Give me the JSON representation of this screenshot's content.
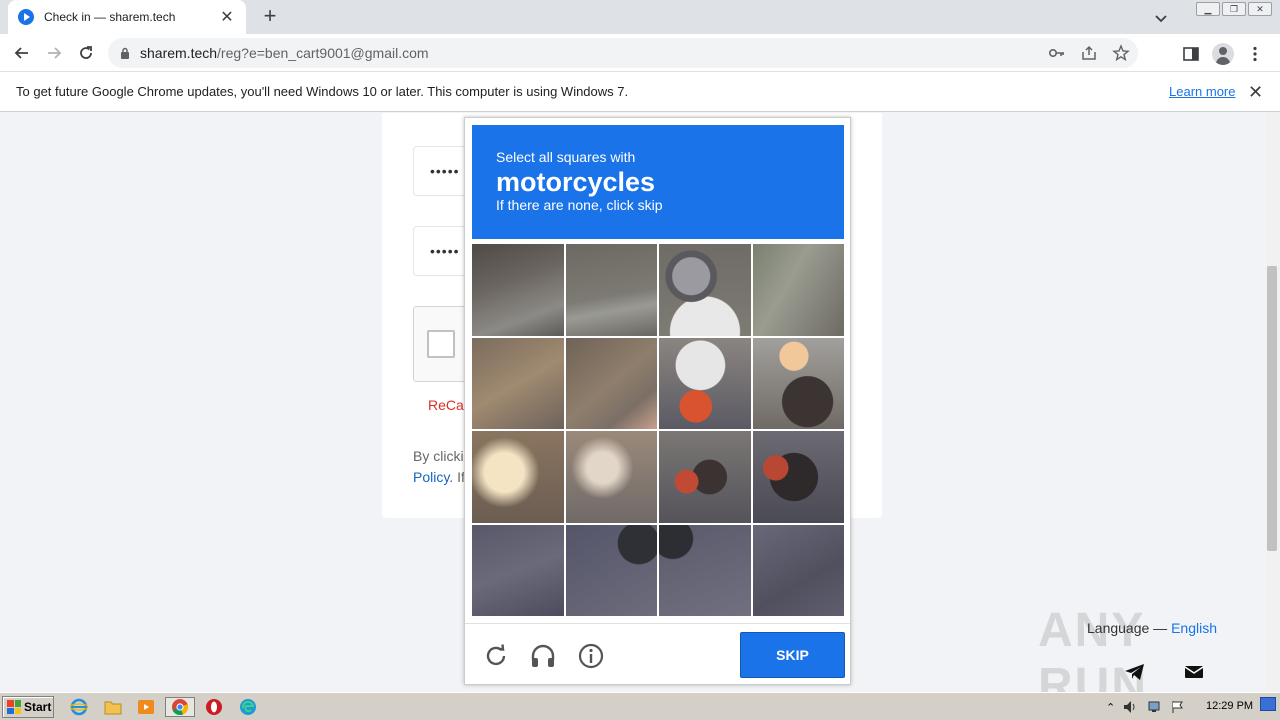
{
  "browser": {
    "tab_title": "Check in — sharem.tech",
    "url_host": "sharem.tech",
    "url_path": "/reg?e=ben_cart9001@gmail.com"
  },
  "infobar": {
    "message": "To get future Google Chrome updates, you'll need Windows 10 or later. This computer is using Windows 7.",
    "link_label": "Learn more"
  },
  "form": {
    "password_mask": "•••••",
    "confirm_mask": "•••••",
    "recaptcha_label": "ReCap",
    "by_clicking_text": "By clicki",
    "policy_link": "Policy.",
    "policy_rest": " If"
  },
  "captcha": {
    "line1": "Select all squares with",
    "keyword": "motorcycles",
    "line3": "If there are none, click skip",
    "skip_label": "SKIP",
    "icons": [
      "reload-icon",
      "headphones-icon",
      "info-icon"
    ]
  },
  "footer": {
    "language_prefix": "Language — ",
    "language_value": "English",
    "watermark": "ANY RUN"
  },
  "taskbar": {
    "start_label": "Start",
    "clock": "12:29 PM"
  },
  "colors": {
    "accent": "#1a73e8",
    "error": "#d93025"
  }
}
